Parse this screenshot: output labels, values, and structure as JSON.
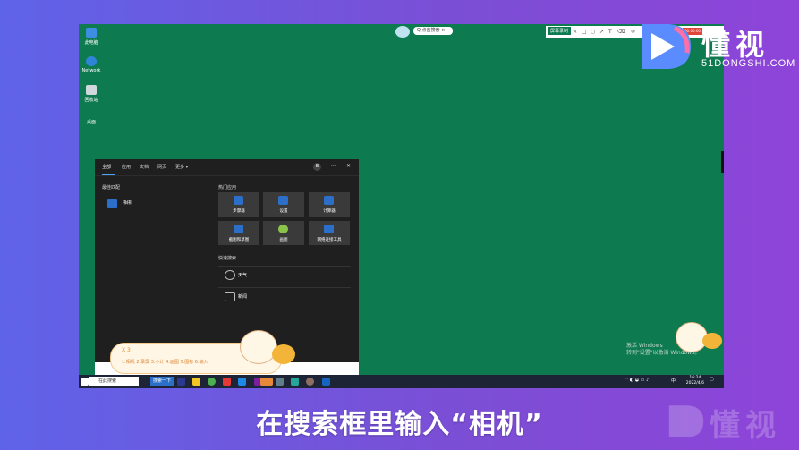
{
  "desktop_icons": [
    {
      "label": "此电脑",
      "icon": "computer-icon",
      "color": "#3d8ee0"
    },
    {
      "label": "Network",
      "icon": "network-icon",
      "color": "#2f84d8"
    },
    {
      "label": "回收站",
      "icon": "recycle-bin-icon",
      "color": "#cfd8dc"
    },
    {
      "label": "桌面",
      "icon": "folder-icon",
      "color": "#0d7a4f"
    }
  ],
  "top_tools": {
    "title": "屏幕录制",
    "pill_text": "Q 点击搜索 ×",
    "stop_label": "00:00:00"
  },
  "start": {
    "tabs": [
      "全部",
      "应用",
      "文档",
      "网页",
      "更多 ▾"
    ],
    "avatar": "B",
    "more_dots": "···",
    "close": "✕",
    "best_label": "最佳匹配",
    "best_app": "相机",
    "top_apps_label": "热门应用",
    "tiles": [
      {
        "label": "步骤器",
        "icon": "steps-icon",
        "color": "#2b6fc8"
      },
      {
        "label": "设置",
        "icon": "gear-icon",
        "color": "#2b6fc8"
      },
      {
        "label": "计算器",
        "icon": "calculator-icon",
        "color": "#2b6fc8"
      },
      {
        "label": "截图和草图",
        "icon": "snip-icon",
        "color": "#2b6fc8"
      },
      {
        "label": "画图",
        "icon": "paint-icon",
        "color": "#8bc34a"
      },
      {
        "label": "网络连接工具",
        "icon": "network-tool-icon",
        "color": "#2b6fc8"
      }
    ],
    "quick_label": "快速搜索",
    "quick": [
      {
        "label": "天气",
        "icon": "weather-icon"
      },
      {
        "label": "新闻",
        "icon": "news-icon"
      }
    ]
  },
  "suggestions": {
    "top": "X 3",
    "items": "1.相机   2.录屏   3.小计   4.画图   5.图标   6.输入"
  },
  "watermark": {
    "line1": "激活 Windows",
    "line2": "转到\"设置\"以激活 Windows。"
  },
  "taskbar": {
    "search": "在此搜索",
    "btn": "搜索一下",
    "time": "16:24",
    "date": "2022/4/6",
    "lang": "中"
  },
  "brand": {
    "name": "懂视",
    "url": "51DONGSHI.COM",
    "primary": "#5a8cff",
    "accent": "#ff6fa8"
  },
  "caption": "在搜索框里输入“相机”"
}
